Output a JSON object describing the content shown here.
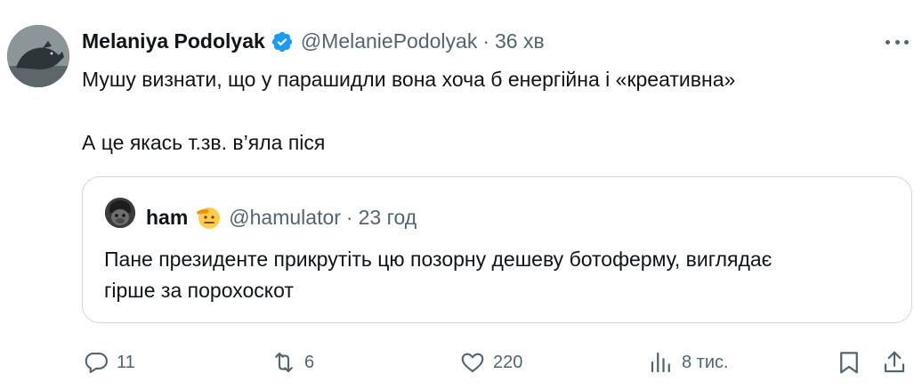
{
  "tweet": {
    "author_name": "Melaniya Podolyak",
    "handle": "@MelaniePodolyak",
    "separator": "·",
    "time": "36 хв",
    "line1": "Мушу визнати, що у парашидли вона хоча б енергійна і «креативна»",
    "line2": "А це якась т.зв. в’яла піся"
  },
  "quote": {
    "author_name": "ham",
    "handle": "@hamulator",
    "separator": "·",
    "time": "23 год",
    "line1": "Пане президенте прикрутіть цю позорну дешеву ботоферму, виглядає",
    "line2": "гірше за порохоскот"
  },
  "actions": {
    "replies": "11",
    "reposts": "6",
    "likes": "220",
    "views": "8 тис."
  },
  "colors": {
    "verified": "#1d9bf0",
    "secondary_text": "#536471",
    "border": "#cfd9de"
  },
  "icons": [
    "verified-badge-icon",
    "more-icon",
    "reply-icon",
    "repost-icon",
    "like-icon",
    "views-icon",
    "bookmark-icon",
    "share-icon",
    "saluting-face-emoji"
  ]
}
